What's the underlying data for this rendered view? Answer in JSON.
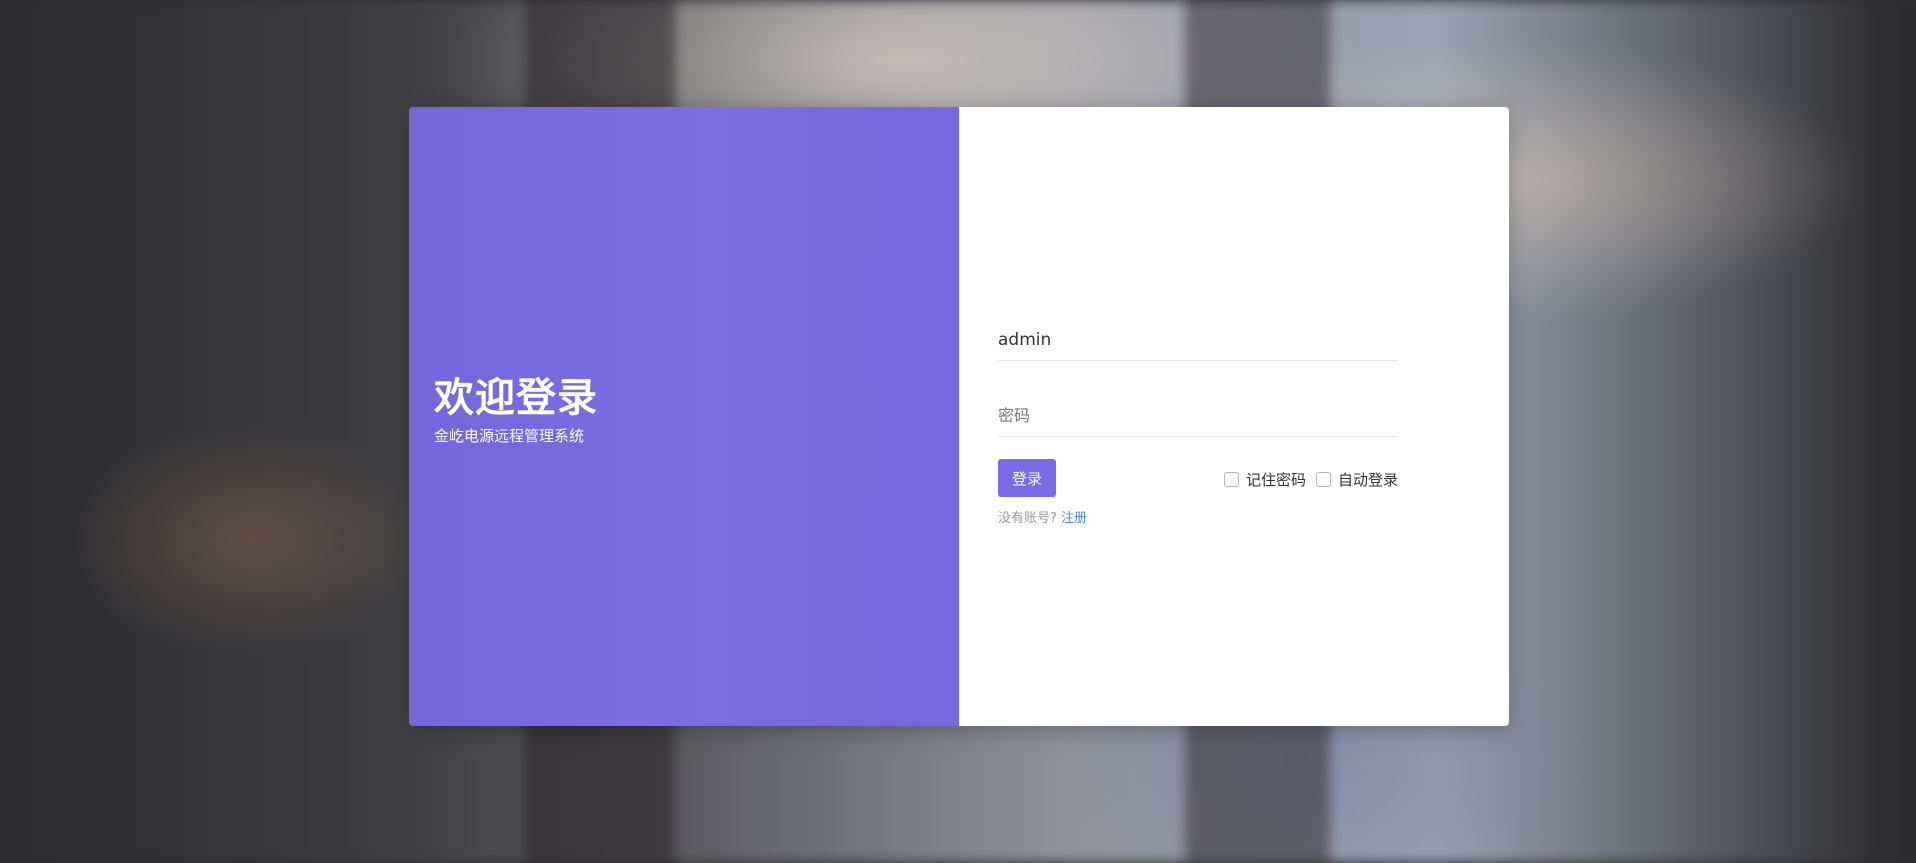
{
  "left_panel": {
    "title": "欢迎登录",
    "subtitle": "金屹电源远程管理系统"
  },
  "login_form": {
    "username_value": "admin",
    "password_placeholder": "密码",
    "login_button": "登录",
    "remember_password": "记住密码",
    "auto_login": "自动登录",
    "no_account_text": "没有账号?",
    "register_link": "注册"
  },
  "colors": {
    "accent": "#7b6be6",
    "panel": "#7566dc",
    "link": "#4a8ee6"
  }
}
